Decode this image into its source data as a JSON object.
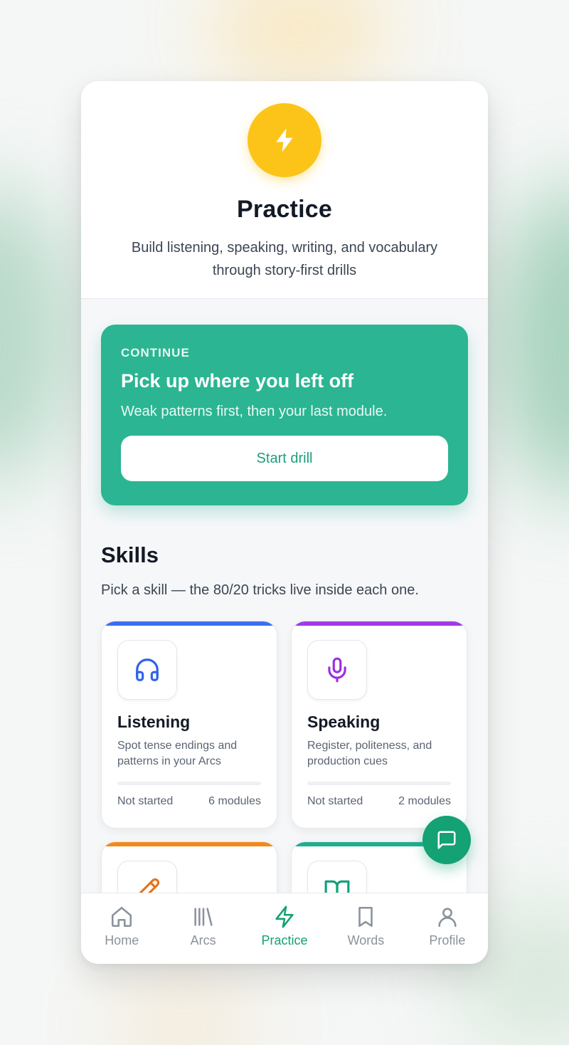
{
  "header": {
    "icon": "lightning-bolt-icon",
    "title": "Practice",
    "subtitle": "Build listening, speaking, writing, and vocabulary through story-first drills"
  },
  "continue_card": {
    "eyebrow": "CONTINUE",
    "title": "Pick up where you left off",
    "description": "Weak patterns first, then your last module.",
    "button_label": "Start drill"
  },
  "skills": {
    "title": "Skills",
    "subtitle": "Pick a skill — the 80/20 tricks live inside each one.",
    "items": [
      {
        "name": "Listening",
        "description": "Spot tense endings and patterns in your Arcs",
        "status": "Not started",
        "modules": "6 modules",
        "icon": "headphones-icon",
        "color": "#3b6ff0"
      },
      {
        "name": "Speaking",
        "description": "Register, politeness, and production cues",
        "status": "Not started",
        "modules": "2 modules",
        "icon": "microphone-icon",
        "color": "#a03ae8"
      },
      {
        "name": "",
        "description": "",
        "status": "",
        "modules": "",
        "icon": "pencil-icon",
        "color": "#f28a1a"
      },
      {
        "name": "",
        "description": "",
        "status": "",
        "modules": "",
        "icon": "book-icon",
        "color": "#1fae8c"
      }
    ]
  },
  "fab": {
    "icon": "chat-icon"
  },
  "nav": {
    "items": [
      {
        "label": "Home",
        "icon": "home-icon"
      },
      {
        "label": "Arcs",
        "icon": "library-icon"
      },
      {
        "label": "Practice",
        "icon": "lightning-bolt-icon"
      },
      {
        "label": "Words",
        "icon": "bookmark-icon"
      },
      {
        "label": "Profile",
        "icon": "user-icon"
      }
    ],
    "active": "Practice"
  },
  "colors": {
    "accent": "#2bb592",
    "primary_green": "#14a173",
    "bolt_yellow": "#fcc419"
  }
}
